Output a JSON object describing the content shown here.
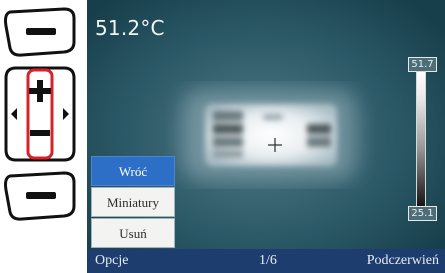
{
  "screen": {
    "temperature": "51.2°C",
    "scale": {
      "max": "51.7",
      "min": "25.1"
    }
  },
  "menu": {
    "items": [
      {
        "label": "Wróć",
        "active": true
      },
      {
        "label": "Miniatury",
        "active": false
      },
      {
        "label": "Usuń",
        "active": false
      }
    ]
  },
  "bottom_bar": {
    "left": "Opcje",
    "center": "1/6",
    "right": "Podczerwień"
  },
  "colors": {
    "menu_active": "#2d6fc6",
    "bottom_bar": "#1c3d6e",
    "highlight": "#d8202a"
  }
}
